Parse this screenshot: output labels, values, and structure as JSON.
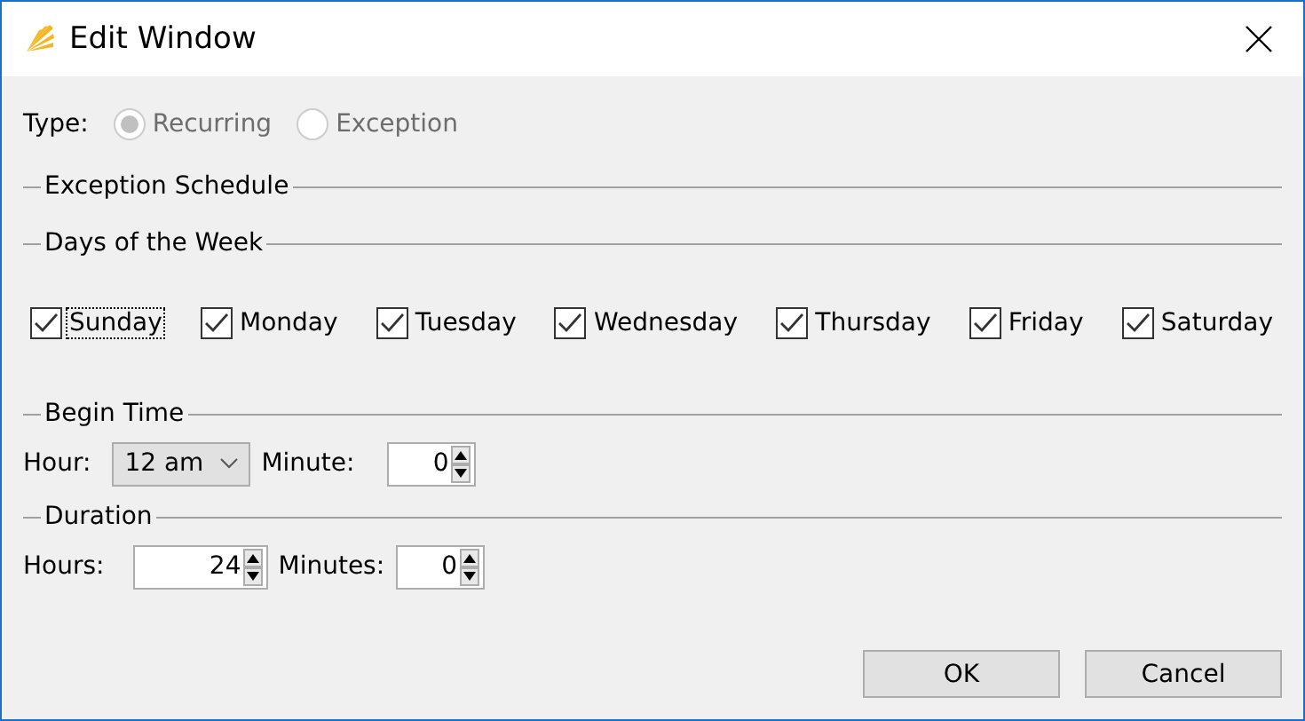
{
  "window": {
    "title": "Edit Window"
  },
  "type": {
    "label": "Type:",
    "disabled": true,
    "options": [
      {
        "label": "Recurring",
        "selected": true
      },
      {
        "label": "Exception",
        "selected": false
      }
    ]
  },
  "exception_schedule": {
    "title": "Exception Schedule"
  },
  "days_of_week": {
    "title": "Days of the Week",
    "days": [
      {
        "label": "Sunday",
        "checked": true,
        "focused": true
      },
      {
        "label": "Monday",
        "checked": true,
        "focused": false
      },
      {
        "label": "Tuesday",
        "checked": true,
        "focused": false
      },
      {
        "label": "Wednesday",
        "checked": true,
        "focused": false
      },
      {
        "label": "Thursday",
        "checked": true,
        "focused": false
      },
      {
        "label": "Friday",
        "checked": true,
        "focused": false
      },
      {
        "label": "Saturday",
        "checked": true,
        "focused": false
      }
    ]
  },
  "begin_time": {
    "title": "Begin Time",
    "hour_label": "Hour:",
    "hour": "12 am",
    "minute_label": "Minute:",
    "minute": "0"
  },
  "duration": {
    "title": "Duration",
    "hours_label": "Hours:",
    "hours": "24",
    "minutes_label": "Minutes:",
    "minutes": "0"
  },
  "buttons": [
    "OK",
    "Cancel"
  ]
}
